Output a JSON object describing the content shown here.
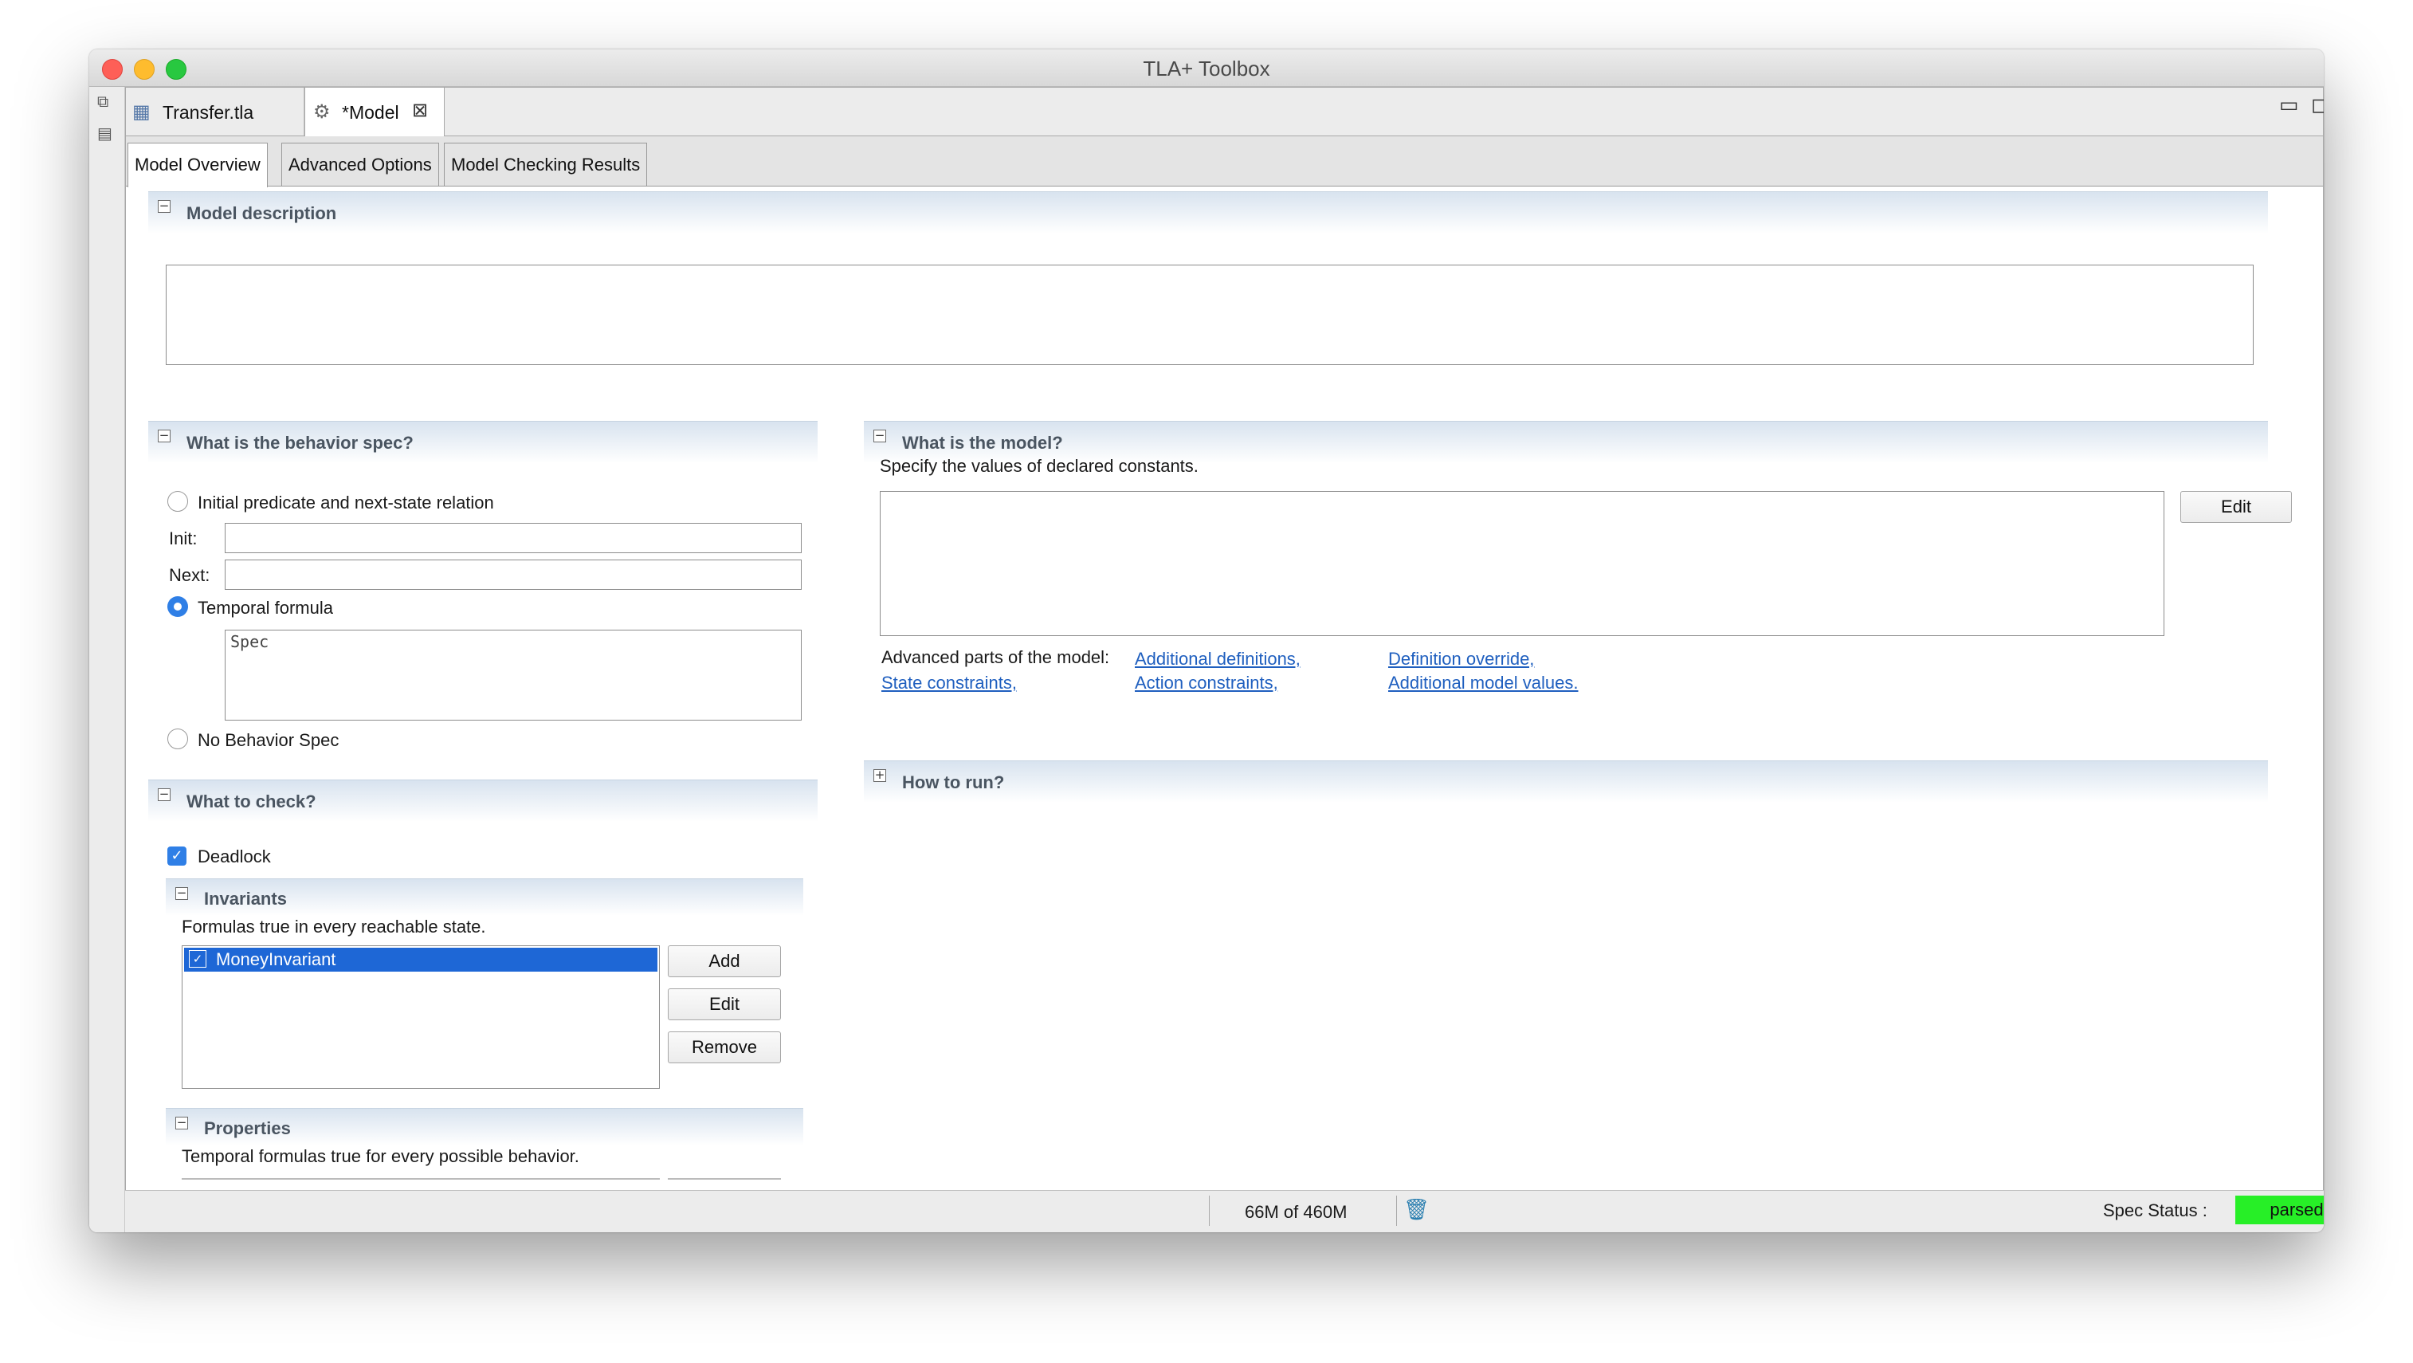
{
  "window": {
    "title": "TLA+ Toolbox"
  },
  "editor_tabs": [
    {
      "label": "Transfer.tla"
    },
    {
      "label": "*Model"
    }
  ],
  "page_tabs": [
    {
      "label": "Model Overview",
      "active": true
    },
    {
      "label": "Advanced Options",
      "active": false
    },
    {
      "label": "Model Checking Results",
      "active": false
    }
  ],
  "model_description": {
    "title": "Model description",
    "value": ""
  },
  "behavior": {
    "title": "What is the behavior spec?",
    "option_init_next": "Initial predicate and next-state relation",
    "init_label": "Init:",
    "init_value": "",
    "next_label": "Next:",
    "next_value": "",
    "option_temporal": "Temporal formula",
    "temporal_value": "Spec",
    "option_none": "No Behavior Spec",
    "selected": "Temporal formula"
  },
  "check": {
    "title": "What to check?",
    "deadlock_label": "Deadlock",
    "deadlock_checked": true,
    "invariants": {
      "title": "Invariants",
      "description": "Formulas true in every reachable state.",
      "items": [
        {
          "label": "MoneyInvariant",
          "checked": true,
          "selected": true
        }
      ],
      "add_label": "Add",
      "edit_label": "Edit",
      "remove_label": "Remove"
    },
    "properties": {
      "title": "Properties",
      "description": "Temporal formulas true for every possible behavior."
    }
  },
  "model": {
    "title": "What is the model?",
    "description": "Specify the values of declared constants.",
    "edit_label": "Edit",
    "advanced_label": "Advanced parts of the model:",
    "links": {
      "additional_definitions": "Additional definitions,",
      "definition_override": "Definition override,",
      "state_constraints": "State constraints,",
      "action_constraints": "Action constraints,",
      "additional_model_values": "Additional model values."
    }
  },
  "how_to_run": {
    "title": "How to run?"
  },
  "status": {
    "memory": "66M of 460M",
    "spec_status_label": "Spec Status :",
    "spec_status_value": "parsed",
    "spec_status_color": "#27ef27"
  },
  "colors": {
    "accent": "#2f7fe6",
    "selection": "#1e67d6",
    "link": "#1f5fbf"
  }
}
